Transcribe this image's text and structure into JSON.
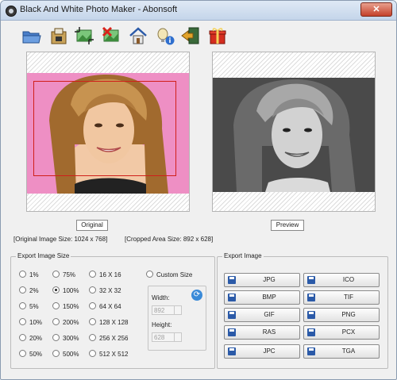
{
  "window": {
    "title": "Black And White Photo Maker - Abonsoft",
    "close_glyph": "✕"
  },
  "toolbar": {
    "items": [
      {
        "icon": "open-folder-icon"
      },
      {
        "icon": "save-icon"
      },
      {
        "icon": "crop-icon"
      },
      {
        "icon": "remove-crop-icon"
      },
      {
        "icon": "home-icon"
      },
      {
        "icon": "info-icon"
      },
      {
        "icon": "exit-icon"
      },
      {
        "icon": "gift-icon"
      }
    ]
  },
  "original": {
    "caption": "Original"
  },
  "preview": {
    "caption": "Preview"
  },
  "info": {
    "original_size": "[Original Image Size:  1024 x 768]",
    "cropped_size": "[Cropped Area Size:  892 x 628]"
  },
  "export_size": {
    "label": "Export Image Size",
    "percent_col1": [
      "1%",
      "2%",
      "5%",
      "10%",
      "20%",
      "50%"
    ],
    "percent_col2": [
      "75%",
      "100%",
      "150%",
      "200%",
      "300%",
      "500%"
    ],
    "fixed": [
      "16 X 16",
      "32 X 32",
      "64 X 64",
      "128 X 128",
      "256 X 256",
      "512 X 512"
    ],
    "selected": "100%",
    "custom_label": "Custom Size",
    "width_label": "Width:",
    "width_value": "892",
    "height_label": "Height:",
    "height_value": "628"
  },
  "export_image": {
    "label": "Export Image",
    "left": [
      "JPG",
      "BMP",
      "GIF",
      "RAS",
      "JPC"
    ],
    "right": [
      "ICO",
      "TIF",
      "PNG",
      "PCX",
      "TGA"
    ]
  },
  "colors": {
    "selection": "#d0201a",
    "pink_bg": "#ee8fc4",
    "close": "#c4402a"
  }
}
